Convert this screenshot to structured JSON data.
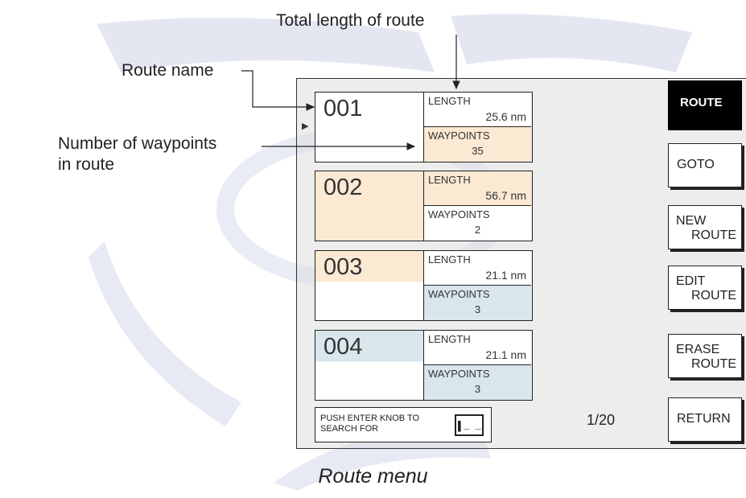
{
  "annotations": {
    "total_length": "Total length of route",
    "route_name": "Route name",
    "waypoints_line1": "Number of waypoints",
    "waypoints_line2": "in route"
  },
  "routes": [
    {
      "name": "001",
      "length_label": "LENGTH",
      "length": "25.6 nm",
      "waypoints_label": "WAYPOINTS",
      "waypoints": "35"
    },
    {
      "name": "002",
      "length_label": "LENGTH",
      "length": "56.7 nm",
      "waypoints_label": "WAYPOINTS",
      "waypoints": "2"
    },
    {
      "name": "003",
      "length_label": "LENGTH",
      "length": "21.1 nm",
      "waypoints_label": "WAYPOINTS",
      "waypoints": "3"
    },
    {
      "name": "004",
      "length_label": "LENGTH",
      "length": "21.1 nm",
      "waypoints_label": "WAYPOINTS",
      "waypoints": "3"
    }
  ],
  "cursor_glyph": "▶",
  "softkeys": {
    "route": "ROUTE",
    "goto": "GOTO",
    "new_l1": "NEW",
    "new_l2": "ROUTE",
    "edit_l1": "EDIT",
    "edit_l2": "ROUTE",
    "erase_l1": "ERASE",
    "erase_l2": "ROUTE",
    "return": "RETURN"
  },
  "search": {
    "line1": "PUSH ENTER KNOB TO",
    "line2": "SEARCH FOR",
    "input_value": "▌_ _"
  },
  "page_indicator": "1/20",
  "caption": "Route menu",
  "colors": {
    "tint_orange": "#fbe9d3",
    "tint_blue": "#d9e6ec",
    "active_key": "#000000"
  }
}
